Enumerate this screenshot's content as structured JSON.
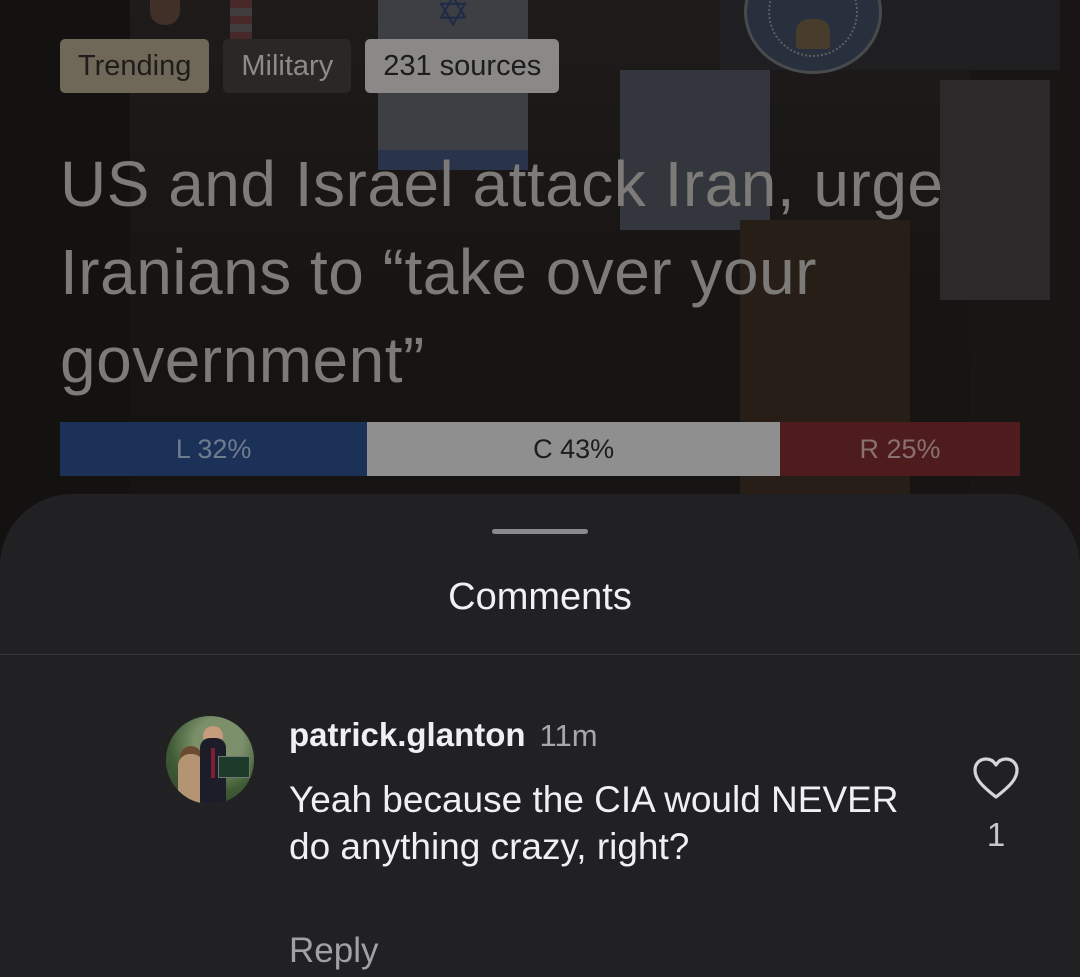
{
  "tags": {
    "trending": "Trending",
    "category": "Military",
    "sources": "231 sources"
  },
  "headline": "US and Israel attack Iran, urge Iranians to “take over your government”",
  "bias": {
    "left": {
      "label": "L 32%",
      "percent": 32,
      "color": "#1b3157"
    },
    "center": {
      "label": "C 43%",
      "percent": 43,
      "color": "#8f8f8f"
    },
    "right": {
      "label": "R 25%",
      "percent": 25,
      "color": "#4e1c1c"
    }
  },
  "comments_panel": {
    "title": "Comments",
    "items": [
      {
        "author": "patrick.glanton",
        "time": "11m",
        "text": "Yeah because the CIA would NEVER do anything crazy, right?",
        "reply_label": "Reply",
        "like_icon": "heart-outline-icon",
        "like_count": "1"
      }
    ]
  }
}
